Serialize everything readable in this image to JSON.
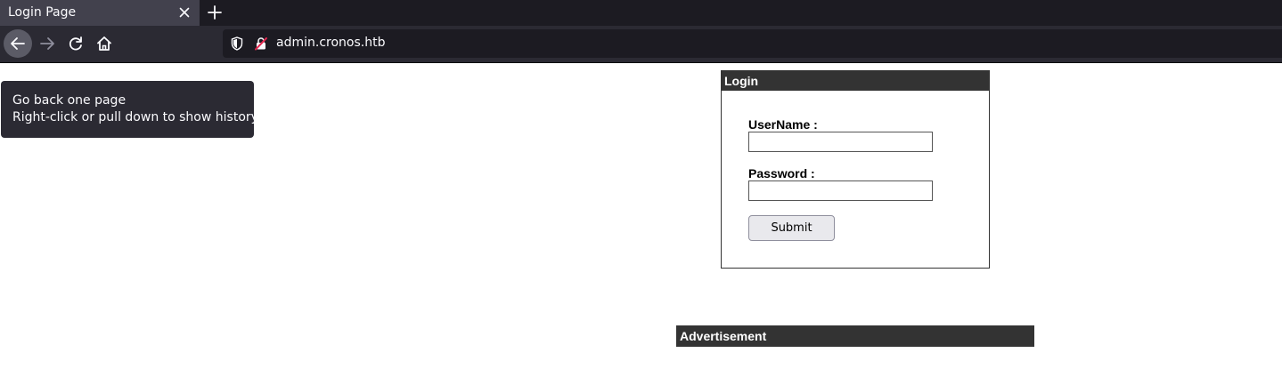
{
  "browser": {
    "tab": {
      "title": "Login Page",
      "close_icon": "close-icon"
    },
    "new_tab_icon": "plus-icon",
    "nav": {
      "back_icon": "arrow-left-icon",
      "forward_icon": "arrow-right-icon",
      "reload_icon": "reload-icon",
      "home_icon": "home-icon"
    },
    "urlbar": {
      "shield_icon": "shield-icon",
      "lock_icon": "insecure-lock-icon",
      "url": "admin.cronos.htb"
    }
  },
  "tooltip": {
    "line1": "Go back one page",
    "line2": "Right-click or pull down to show history"
  },
  "login": {
    "header": "Login",
    "username_label": "UserName :",
    "username_value": "",
    "password_label": "Password :",
    "password_value": "",
    "submit_label": "Submit"
  },
  "advertisement": {
    "header": "Advertisement"
  },
  "colors": {
    "panel_header_bg": "#333333",
    "tabbar_bg": "#1c1b22",
    "navbar_bg": "#2b2a33",
    "insecure_accent": "#e22850"
  }
}
